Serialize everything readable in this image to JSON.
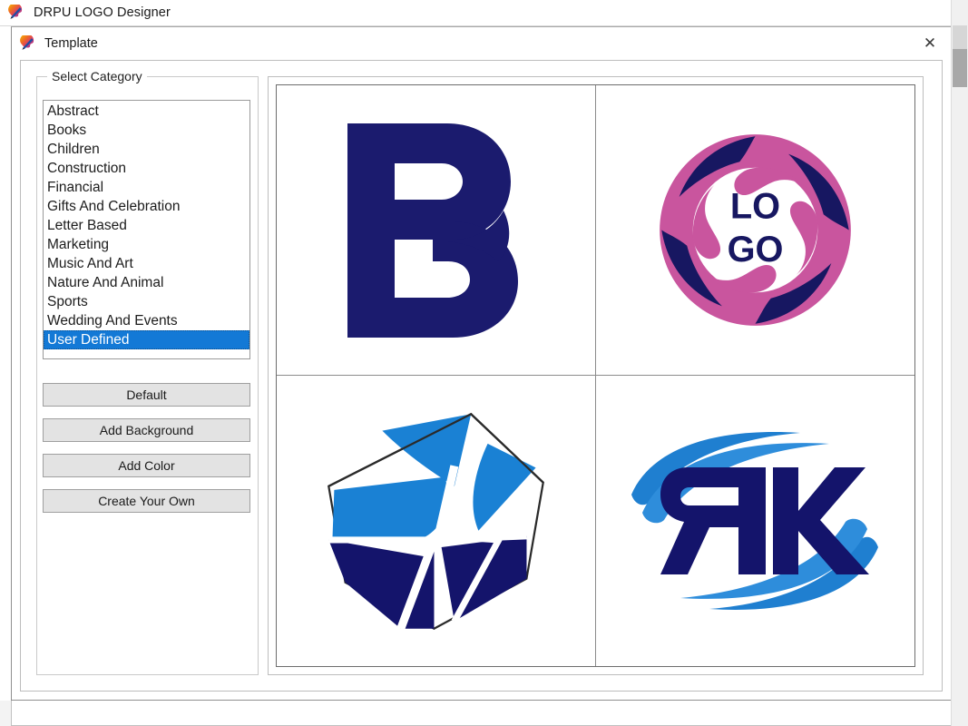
{
  "app": {
    "title": "DRPU LOGO Designer",
    "icon": "palette-brush-icon"
  },
  "dialog": {
    "title": "Template",
    "icon": "palette-brush-icon",
    "close_label": "✕"
  },
  "sidebar": {
    "group_title": "Select Category",
    "categories": [
      {
        "label": "Abstract",
        "selected": false
      },
      {
        "label": "Books",
        "selected": false
      },
      {
        "label": "Children",
        "selected": false
      },
      {
        "label": "Construction",
        "selected": false
      },
      {
        "label": "Financial",
        "selected": false
      },
      {
        "label": "Gifts And Celebration",
        "selected": false
      },
      {
        "label": "Letter Based",
        "selected": false
      },
      {
        "label": "Marketing",
        "selected": false
      },
      {
        "label": "Music And Art",
        "selected": false
      },
      {
        "label": "Nature And Animal",
        "selected": false
      },
      {
        "label": "Sports",
        "selected": false
      },
      {
        "label": "Wedding And Events",
        "selected": false
      },
      {
        "label": "User Defined",
        "selected": true
      }
    ],
    "selected_category": "User Defined",
    "buttons": {
      "default": "Default",
      "add_background": "Add Background",
      "add_color": "Add Color",
      "create_your_own": "Create Your Own"
    }
  },
  "templates": [
    {
      "name": "pb-monogram-logo",
      "text": "PB",
      "colors": [
        "#1b1b6e"
      ]
    },
    {
      "name": "logo-circle-hands-logo",
      "text": "LO GO",
      "line1": "LO",
      "line2": "GO",
      "colors": [
        "#c9559e",
        "#171761"
      ]
    },
    {
      "name": "hexagon-abstract-logo",
      "text": "",
      "colors": [
        "#1a81d4",
        "#14146b"
      ]
    },
    {
      "name": "rk-swoosh-logo",
      "text": "ЯK",
      "colors": [
        "#14146b",
        "#1f7fd0"
      ]
    }
  ],
  "colors": {
    "accent_selection": "#1379d6",
    "navy": "#1b1b6e",
    "pink": "#c9559e",
    "light_blue": "#1f7fd0",
    "button_face": "#e3e3e3"
  }
}
